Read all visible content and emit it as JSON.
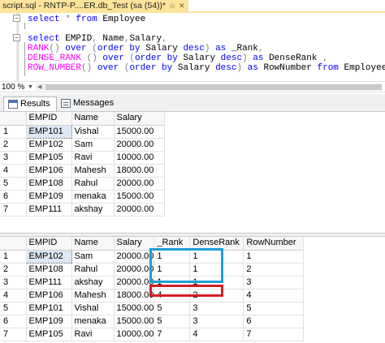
{
  "document_tab": {
    "title": "script.sql - RNTP-P....ER.db_Test (sa (54))*",
    "pin_icon": "pin-icon",
    "close_icon": "close-icon"
  },
  "editor": {
    "lines": [
      {
        "parts": [
          {
            "t": "select",
            "c": "kw"
          },
          {
            "t": " * ",
            "c": "gray"
          },
          {
            "t": "from",
            "c": "kw"
          },
          {
            "t": " Employee",
            "c": ""
          }
        ]
      },
      {
        "parts": []
      },
      {
        "parts": [
          {
            "t": "select",
            "c": "kw"
          },
          {
            "t": " EMPID",
            "c": ""
          },
          {
            "t": ",",
            "c": "gray"
          },
          {
            "t": " Name",
            "c": ""
          },
          {
            "t": ",",
            "c": "gray"
          },
          {
            "t": "Salary",
            "c": ""
          },
          {
            "t": ",",
            "c": "gray"
          }
        ]
      },
      {
        "parts": [
          {
            "t": "RANK",
            "c": "fn"
          },
          {
            "t": "() ",
            "c": "gray"
          },
          {
            "t": "over",
            "c": "kw"
          },
          {
            "t": " (",
            "c": "gray"
          },
          {
            "t": "order by",
            "c": "kw"
          },
          {
            "t": " Salary ",
            "c": ""
          },
          {
            "t": "desc",
            "c": "kw"
          },
          {
            "t": ") ",
            "c": "gray"
          },
          {
            "t": "as",
            "c": "kw"
          },
          {
            "t": " _Rank",
            "c": ""
          },
          {
            "t": ",",
            "c": "gray"
          }
        ]
      },
      {
        "parts": [
          {
            "t": "DENSE_RANK",
            "c": "fn"
          },
          {
            "t": " () ",
            "c": "gray"
          },
          {
            "t": "over",
            "c": "kw"
          },
          {
            "t": " (",
            "c": "gray"
          },
          {
            "t": "order by",
            "c": "kw"
          },
          {
            "t": " Salary ",
            "c": ""
          },
          {
            "t": "desc",
            "c": "kw"
          },
          {
            "t": ") ",
            "c": "gray"
          },
          {
            "t": "as",
            "c": "kw"
          },
          {
            "t": " DenseRank ",
            "c": ""
          },
          {
            "t": ",",
            "c": "gray"
          }
        ]
      },
      {
        "parts": [
          {
            "t": "ROW_NUMBER",
            "c": "fn"
          },
          {
            "t": "() ",
            "c": "gray"
          },
          {
            "t": "over",
            "c": "kw"
          },
          {
            "t": " (",
            "c": "gray"
          },
          {
            "t": "order by",
            "c": "kw"
          },
          {
            "t": " Salary ",
            "c": ""
          },
          {
            "t": "desc",
            "c": "kw"
          },
          {
            "t": ") ",
            "c": "gray"
          },
          {
            "t": "as",
            "c": "kw"
          },
          {
            "t": " RowNumber ",
            "c": ""
          },
          {
            "t": "from",
            "c": "kw"
          },
          {
            "t": " Employee",
            "c": ""
          }
        ]
      }
    ]
  },
  "zoom": {
    "level": "100 %"
  },
  "result_tabs": [
    {
      "label": "Results",
      "icon": "grid-icon"
    },
    {
      "label": "Messages",
      "icon": "messages-icon"
    }
  ],
  "grid1": {
    "columns": [
      "EMPID",
      "Name",
      "Salary"
    ],
    "rows": [
      [
        "1",
        "EMP101",
        "Vishal",
        "15000.00"
      ],
      [
        "2",
        "EMP102",
        "Sam",
        "20000.00"
      ],
      [
        "3",
        "EMP105",
        "Ravi",
        "10000.00"
      ],
      [
        "4",
        "EMP106",
        "Mahesh",
        "18000.00"
      ],
      [
        "5",
        "EMP108",
        "Rahul",
        "20000.00"
      ],
      [
        "6",
        "EMP109",
        "menaka",
        "15000.00"
      ],
      [
        "7",
        "EMP111",
        "akshay",
        "20000.00"
      ]
    ]
  },
  "grid2": {
    "columns": [
      "EMPID",
      "Name",
      "Salary",
      "_Rank",
      "DenseRank",
      "RowNumber"
    ],
    "rows": [
      [
        "1",
        "EMP102",
        "Sam",
        "20000.00",
        "1",
        "1",
        "1"
      ],
      [
        "2",
        "EMP108",
        "Rahul",
        "20000.00",
        "1",
        "1",
        "2"
      ],
      [
        "3",
        "EMP111",
        "akshay",
        "20000.00",
        "1",
        "1",
        "3"
      ],
      [
        "4",
        "EMP106",
        "Mahesh",
        "18000.00",
        "4",
        "2",
        "4"
      ],
      [
        "5",
        "EMP101",
        "Vishal",
        "15000.00",
        "5",
        "3",
        "5"
      ],
      [
        "6",
        "EMP109",
        "menaka",
        "15000.00",
        "5",
        "3",
        "6"
      ],
      [
        "7",
        "EMP105",
        "Ravi",
        "10000.00",
        "7",
        "4",
        "7"
      ]
    ]
  },
  "colors": {
    "tab_active": "#fde49b",
    "keyword": "#0000ff",
    "function": "#ff00ff",
    "highlight_blue": "#1f9fd8",
    "highlight_red": "#d41e27"
  }
}
